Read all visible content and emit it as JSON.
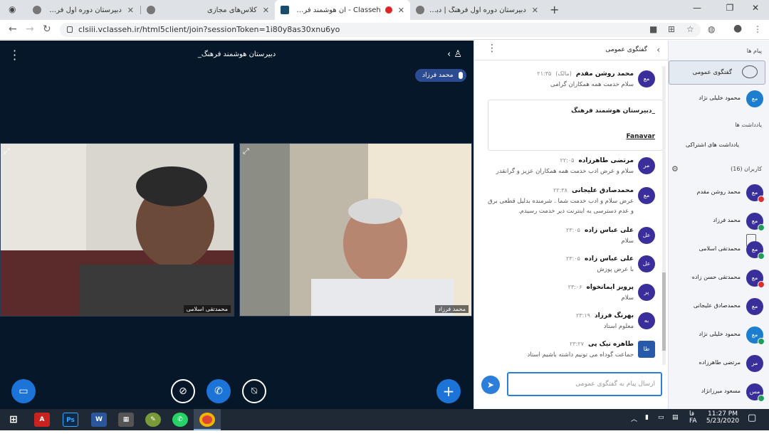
{
  "browser": {
    "tabs": [
      {
        "title": "دبیرستان دوره اول فرهنگ"
      },
      {
        "title": "کلاس‌های مجازی"
      },
      {
        "title": "Classeh - ان هوشمند فرهنگ_"
      },
      {
        "title": "دبیرستان دوره اول فرهنگ | دبیرستا"
      }
    ],
    "url": "clsiii.vclasseh.ir/html5client/join?sessionToken=1i80y8as30xnu6yo"
  },
  "stage": {
    "title": "_دبیرستان هوشمند فرهنگ",
    "talker": "محمد فرزاد",
    "videos": [
      {
        "label": "محمدتقی اسلامی"
      },
      {
        "label": "محمد فرزاد"
      }
    ]
  },
  "chat": {
    "header": "گفتگوی عمومی",
    "messages": [
      {
        "initials": "مع",
        "name": "محمد روشن مقدم",
        "badge": "(مالک)",
        "time": "۲۱:۳۵",
        "text": "سلام خدمت همه همکاران گرامی"
      },
      {
        "initials": "مر",
        "name": "مرتضی طاهرزاده",
        "time": "۲۲:۰۵",
        "text": "سلام و عرض ادب خدمت همه همکاران عزیز و گرانقدر"
      },
      {
        "initials": "مع",
        "name": "محمدصادق علیجانی",
        "time": "۲۲:۳۸",
        "text": "عرض سلام و ادب خدمت شما . شرمنده بدلیل قطعی برق و عدم دسترسی به اینترنت دیر خدمت رسیدم."
      },
      {
        "initials": "عل",
        "name": "علی عباس زاده",
        "time": "۲۳:۰۵",
        "text": "سلام"
      },
      {
        "initials": "عل",
        "name": "علی عباس زاده",
        "time": "۲۳:۰۵",
        "text": "با عرض پوزش"
      },
      {
        "initials": "پر",
        "name": "پرویز ایمانخواه",
        "time": "۲۳:۰۶",
        "text": "سلام"
      },
      {
        "initials": "به",
        "name": "بهرنگ فرزاد",
        "time": "۲۳:۱۹",
        "text": "معلوم استاد"
      },
      {
        "initials": "طا",
        "name": "طاهره نیک پی",
        "time": "۲۳:۲۷",
        "text": "جماعت گوداه می تونیم داشته باشیم استاد"
      }
    ],
    "welcome": {
      "line1": "_دبیرستان هوشمند فرهنگ",
      "line2": "Fanavar"
    },
    "compose_placeholder": "ارسال پیام به گفتگوی عمومی"
  },
  "sidebar": {
    "messages_title": "پیام ها",
    "public_chat": "گفتگوی عمومی",
    "private_chat": {
      "initials": "مع",
      "name": "محمود خلیلی نژاد"
    },
    "notes_title": "یادداشت ها",
    "shared_notes": "یادداشت های اشتراکی",
    "users_title": "کاربران (16)",
    "users": [
      {
        "initials": "مع",
        "name": "محمد روشن مقدم"
      },
      {
        "initials": "مع",
        "name": "محمد فرزاد"
      },
      {
        "initials": "مع",
        "name": "محمدتقی اسلامی"
      },
      {
        "initials": "مع",
        "name": "محمدتقی حسن زاده"
      },
      {
        "initials": "مع",
        "name": "محمدصادق علیجانی"
      },
      {
        "initials": "مع",
        "name": "محمود خلیلی نژاد"
      },
      {
        "initials": "مر",
        "name": "مرتضی طاهرزاده"
      },
      {
        "initials": "مس",
        "name": "مسعود میرزانژاد"
      }
    ]
  },
  "taskbar": {
    "time": "11:27 PM",
    "date": "5/23/2020",
    "lang": "FA",
    "lang2": "فا"
  }
}
